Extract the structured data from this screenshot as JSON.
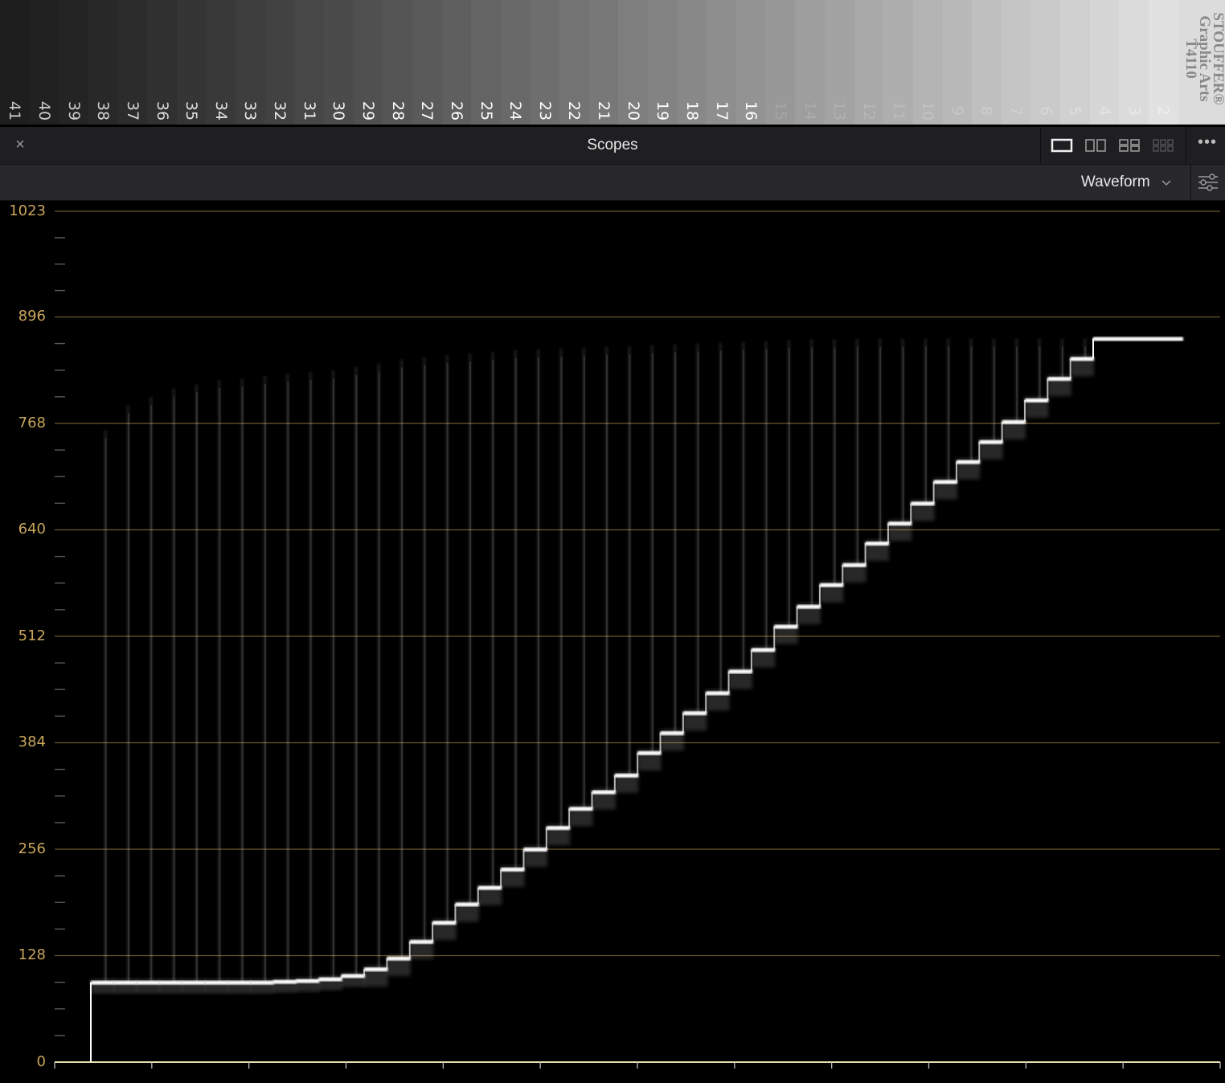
{
  "chart_strip": {
    "step_numbers": [
      "41",
      "40",
      "39",
      "38",
      "37",
      "36",
      "35",
      "34",
      "33",
      "32",
      "31",
      "30",
      "29",
      "28",
      "27",
      "26",
      "25",
      "24",
      "23",
      "22",
      "21",
      "20",
      "19",
      "18",
      "17",
      "16",
      "15",
      "14",
      "13",
      "12",
      "11",
      "10",
      "9",
      "8",
      "7",
      "6",
      "5",
      "4",
      "3",
      "2"
    ],
    "brand_lines": [
      "STOUFFER®",
      "Graphic Arts",
      "T4110"
    ]
  },
  "panel": {
    "title": "Scopes",
    "close_glyph": "×",
    "more_glyph": "•••",
    "scope_type": "Waveform"
  },
  "colors": {
    "axis": "#c8a55a",
    "grid": "#6b5a2e",
    "panel": "#1f1f22",
    "toolbar": "#28282c"
  },
  "chart_data": {
    "type": "waveform",
    "yticks": [
      "1023",
      "896",
      "768",
      "640",
      "512",
      "384",
      "256",
      "128",
      "0"
    ],
    "ylim": [
      0,
      1023
    ],
    "steps": [
      96,
      96,
      96,
      96,
      96,
      96,
      96,
      96,
      97,
      98,
      100,
      104,
      112,
      125,
      145,
      168,
      190,
      210,
      232,
      256,
      282,
      305,
      325,
      345,
      372,
      396,
      420,
      444,
      470,
      496,
      524,
      548,
      574,
      598,
      624,
      648,
      672,
      698,
      722,
      746,
      770,
      796,
      822,
      846
    ],
    "white_level": 870,
    "peak_levels": [
      760,
      790,
      800,
      810,
      815,
      820,
      822,
      825,
      828,
      830,
      832,
      836,
      840,
      845,
      848,
      850,
      852,
      854,
      856,
      857,
      858,
      859,
      860,
      861,
      862,
      863,
      864,
      865,
      866,
      867,
      868,
      869,
      869,
      870,
      870,
      870,
      870,
      870,
      870,
      870,
      870,
      870,
      870,
      870
    ],
    "grid": true
  }
}
